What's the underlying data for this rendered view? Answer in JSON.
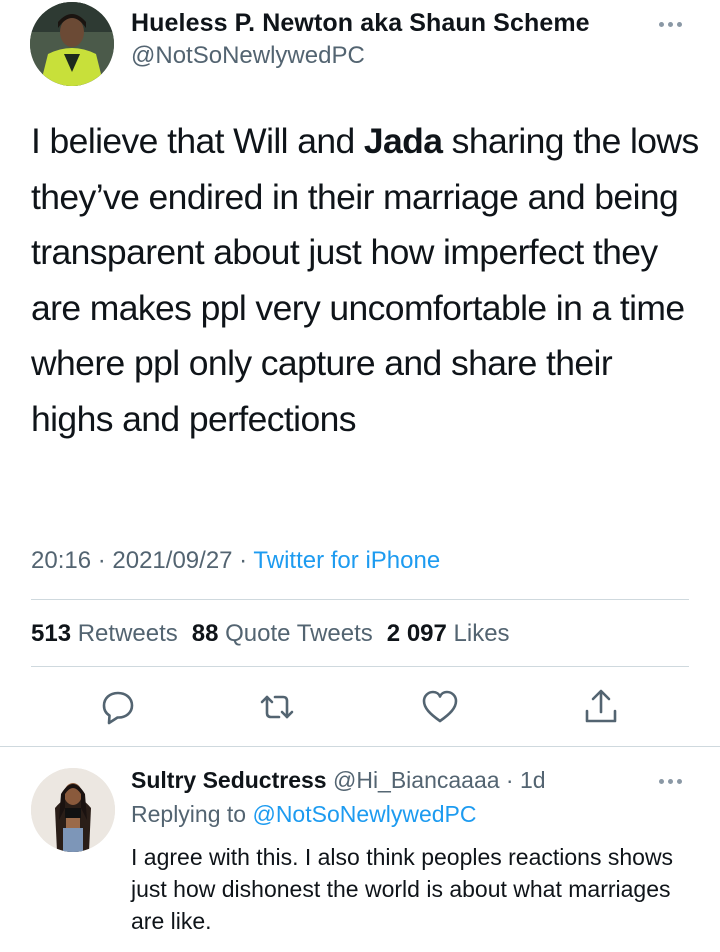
{
  "tweet": {
    "author": {
      "display_name": "Hueless P. Newton aka Shaun Scheme",
      "handle": "@NotSoNewlywedPC"
    },
    "text": {
      "part1": "I believe that Will and ",
      "bold": "Jada",
      "part2": " sharing the lows they’ve endired in their marriage and being transparent about just how imperfect they are makes ppl very uncomfortable in a time where ppl only capture and share their highs and perfections"
    },
    "meta": {
      "time": "20:16",
      "date": "2021/09/27",
      "source": "Twitter for iPhone",
      "separator": " · "
    },
    "stats": {
      "retweets_count": "513",
      "retweets_label": "Retweets",
      "quotes_count": "88",
      "quotes_label": "Quote Tweets",
      "likes_count": "2 097",
      "likes_label": "Likes"
    },
    "actions": [
      "reply-icon",
      "retweet-icon",
      "like-icon",
      "share-icon"
    ]
  },
  "reply": {
    "display_name": "Sultry Seductress",
    "handle": "@Hi_Biancaaaa",
    "time": "1d",
    "replying_label": "Replying to",
    "replying_to": "@NotSoNewlywedPC",
    "text": "I agree with this. I also think peoples reactions shows just how dishonest the world is about what marriages are like."
  },
  "colors": {
    "accent": "#1d9bf0",
    "secondary_text": "#536471",
    "primary_text": "#0f1419",
    "divider": "#cfd9de"
  }
}
